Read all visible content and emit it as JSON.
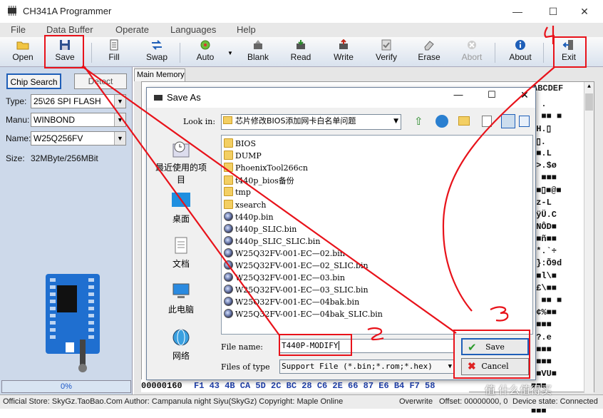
{
  "app": {
    "title": "CH341A Programmer"
  },
  "menu": [
    "File",
    "Data Buffer",
    "Operate",
    "Languages",
    "Help"
  ],
  "toolbar": {
    "open": "Open",
    "save": "Save",
    "fill": "Fill",
    "swap": "Swap",
    "auto": "Auto",
    "blank": "Blank",
    "read": "Read",
    "write": "Write",
    "verify": "Verify",
    "erase": "Erase",
    "abort": "Abort",
    "about": "About",
    "exit": "Exit"
  },
  "left": {
    "chip_search": "Chip Search",
    "detect": "Detect",
    "type_label": "Type:",
    "type_value": "25\\26 SPI FLASH",
    "manu_label": "Manu:",
    "manu_value": "WINBOND",
    "name_label": "Name:",
    "name_value": "W25Q256FV",
    "size_label": "Size:",
    "size_value": "32MByte/256MBit",
    "progress": "0%"
  },
  "main": {
    "tab": "Main Memory",
    "hex_header": "ABCDEF",
    "ascii_rows": [
      "l .",
      "■ ■■ ■",
      "UH.▯",
      "[▯.",
      "■■.L",
      "->.$ø",
      "■ ■■■",
      "[■▯■@■",
      "ûz-L",
      "■ÿÜ.C",
      "TNÔD■",
      "■■ñ■■",
      "@*.`÷",
      "`}:Õ9d",
      "■■l\\■",
      "Ç£\\■■",
      "■ ■■ ■",
      "Ä¢%■■",
      "■■■■",
      ">?.e",
      "■■■■",
      "■■■■",
      "■■VU■",
      "■■■",
      ".[*",
      "■■■"
    ],
    "address": "00000160",
    "hex_bytes": "F1 43 4B CA 5D 2C BC 28 C6 2E 66 87 E6 B4 F7 58"
  },
  "dialog": {
    "title": "Save As",
    "look_in_label": "Look in:",
    "look_in_value": "芯片修改BIOS添加网卡白名单问题",
    "places": [
      "最近使用的项目",
      "桌面",
      "文档",
      "此电脑",
      "网络"
    ],
    "items": [
      {
        "name": "BIOS",
        "kind": "folder"
      },
      {
        "name": "DUMP",
        "kind": "folder"
      },
      {
        "name": "PhoenixTool266cn",
        "kind": "folder"
      },
      {
        "name": "t440p_bios备份",
        "kind": "folder"
      },
      {
        "name": "tmp",
        "kind": "folder"
      },
      {
        "name": "xsearch",
        "kind": "folder"
      },
      {
        "name": "t440p.bin",
        "kind": "file"
      },
      {
        "name": "t440p_SLIC.bin",
        "kind": "file"
      },
      {
        "name": "t440p_SLIC_SLIC.bin",
        "kind": "file"
      },
      {
        "name": "W25Q32FV-001-EC—02.bin",
        "kind": "file"
      },
      {
        "name": "W25Q32FV-001-EC—02_SLIC.bin",
        "kind": "file"
      },
      {
        "name": "W25Q32FV-001-EC—03.bin",
        "kind": "file"
      },
      {
        "name": "W25Q32FV-001-EC—03_SLIC.bin",
        "kind": "file"
      },
      {
        "name": "W25Q32FV-001-EC—04bak.bin",
        "kind": "file"
      },
      {
        "name": "W25Q32FV-001-EC—04bak_SLIC.bin",
        "kind": "file"
      }
    ],
    "filename_label": "File name:",
    "filename_value": "T440P-MODIFY",
    "filetype_label": "Files of type",
    "filetype_value": "Support File (*.bin;*.rom;*.hex)",
    "save_button": "Save",
    "cancel_button": "Cancel"
  },
  "status": {
    "store": "Official Store: SkyGz.TaoBao.Com Author: Campanula night Siyu(SkyGz) Copyright: Maple Online",
    "mode": "Overwrite",
    "offset": "Offset: 00000000, 0",
    "device": "Device state: Connected",
    "watermark": "值 什么值得买"
  },
  "annotations": {
    "n2": "2",
    "n3": "3",
    "n4": "4"
  },
  "colors": {
    "accent": "#1f5fb8",
    "annotation": "#e8121a",
    "toolbar_bg": "#d9e2ee",
    "panel_bg": "#cdd9ea"
  }
}
